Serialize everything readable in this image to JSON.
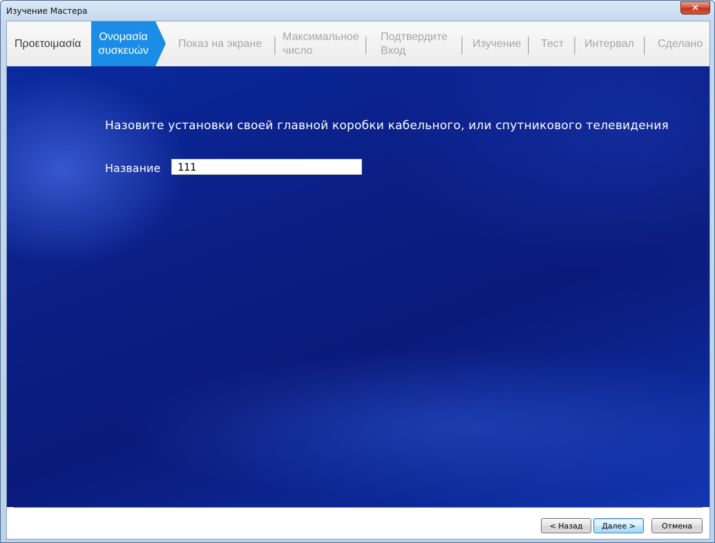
{
  "window": {
    "title": "Изучение Мастера",
    "close_glyph": "✕"
  },
  "steps": [
    {
      "lines": [
        "Προετοιμασία"
      ],
      "state": "done"
    },
    {
      "lines": [
        "Ονομασία",
        "συσκευών"
      ],
      "state": "active"
    },
    {
      "lines": [
        "Показ на экране"
      ],
      "state": "pending"
    },
    {
      "lines": [
        "Максимальное",
        "число"
      ],
      "state": "pending"
    },
    {
      "lines": [
        "Подтвердите",
        "Вход"
      ],
      "state": "pending"
    },
    {
      "lines": [
        "Изучение"
      ],
      "state": "pending"
    },
    {
      "lines": [
        "Тест"
      ],
      "state": "pending"
    },
    {
      "lines": [
        "Интервал"
      ],
      "state": "pending"
    },
    {
      "lines": [
        "Сделано"
      ],
      "state": "pending"
    }
  ],
  "main": {
    "prompt": "Назовите установки своей главной коробки кабельного, или спутникового телевидения",
    "name_label": "Название",
    "name_value": "111"
  },
  "footer": {
    "back_label": "< Назад",
    "next_label": "Далее >",
    "cancel_label": "Отмена"
  },
  "colors": {
    "active_step": "#1b8de6",
    "content_bg": "#0b1f86"
  }
}
